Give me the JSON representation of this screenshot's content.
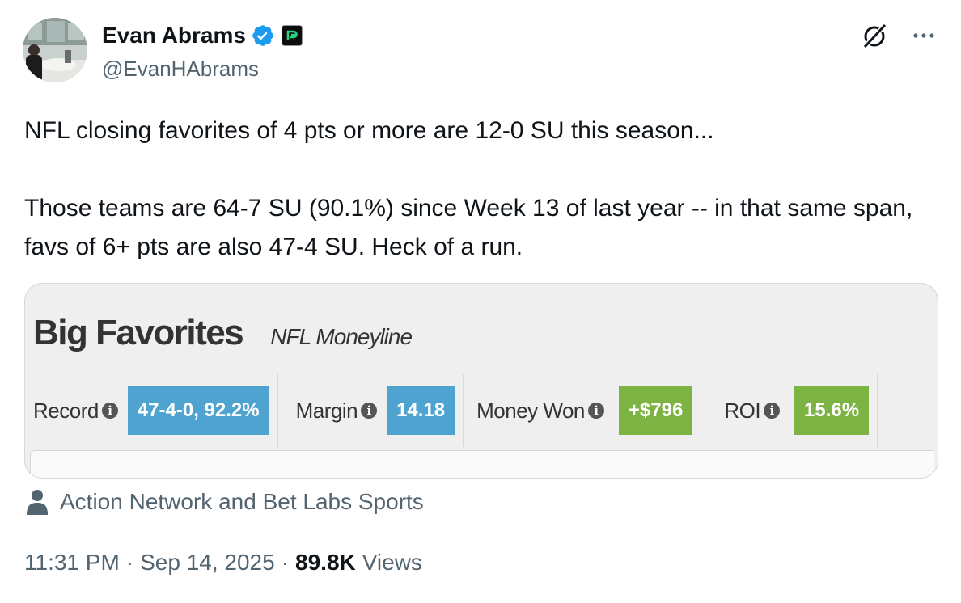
{
  "author": {
    "name": "Evan Abrams",
    "handle": "@EvanHAbrams"
  },
  "tweet": {
    "line1": "NFL closing favorites of 4 pts or more are 12-0 SU this season...",
    "line2": "Those teams are 64-7 SU (90.1%) since Week 13 of last year -- in that same span, favs of 6+ pts are also 47-4 SU. Heck of a run."
  },
  "card": {
    "title": "Big Favorites",
    "subtitle": "NFL Moneyline",
    "info_glyph": "i",
    "stats": [
      {
        "label": "Record",
        "value": "47-4-0, 92.2%",
        "color": "#4fa3d1"
      },
      {
        "label": "Margin ",
        "value": "14.18",
        "color": "#4fa3d1"
      },
      {
        "label": "Money Won",
        "value": "+$796",
        "color": "#7cb342"
      },
      {
        "label": "ROI",
        "value": "15.6%",
        "color": "#7cb342"
      }
    ]
  },
  "source": {
    "icon": "person-icon",
    "text": "Action Network and Bet Labs Sports"
  },
  "meta": {
    "time": "11:31 PM",
    "date": "Sep 14, 2025",
    "views_count": "89.8K",
    "views_label": "Views",
    "separator": "·"
  },
  "colors": {
    "verified": "#1d9bf0",
    "text_primary": "#0f1419",
    "text_secondary": "#536471"
  }
}
